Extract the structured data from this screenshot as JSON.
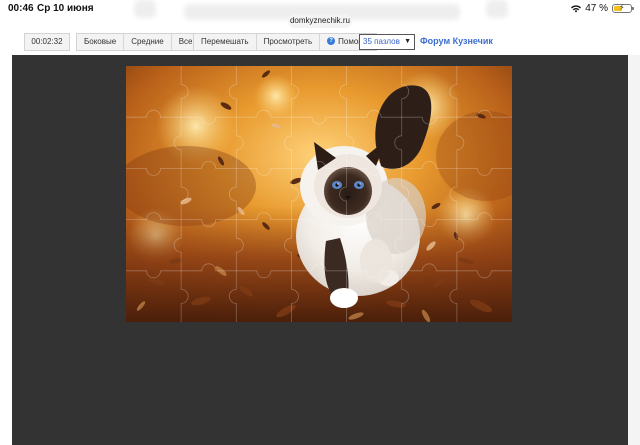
{
  "status_bar": {
    "time": "00:46",
    "date": "Ср 10 июня",
    "battery": "47 %",
    "battery_level": 0.47
  },
  "browser": {
    "url": "domkyznechik.ru"
  },
  "toolbar": {
    "timer": "00:02:32",
    "edge_button": "Боковые",
    "middle_button": "Средние",
    "all_button": "Все",
    "shuffle_button": "Перемешать",
    "preview_button": "Просмотреть",
    "help_button": "Помощь",
    "pieces_select": "35 пазлов",
    "forum_link": "Форум Кузнечик"
  },
  "puzzle": {
    "rows": 5,
    "cols": 7,
    "image_subject": "Birman cat walking through autumn leaves"
  },
  "colors": {
    "board_background": "#333333",
    "link": "#3d6fd0",
    "select_text": "#3a63c8"
  }
}
